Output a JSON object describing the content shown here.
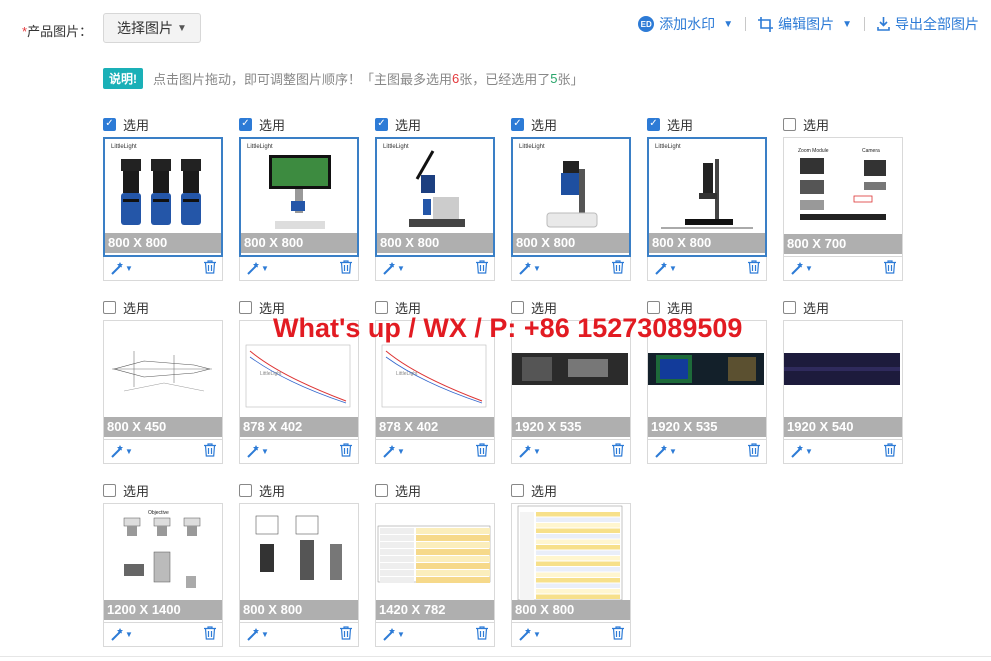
{
  "header": {
    "required_mark": "*",
    "label": "产品图片：",
    "select_button": "选择图片",
    "actions": [
      {
        "name": "add-watermark",
        "label": "添加水印",
        "icon": "watermark-icon"
      },
      {
        "name": "edit-image",
        "label": "编辑图片",
        "icon": "crop-icon"
      },
      {
        "name": "export-all",
        "label": "导出全部图片",
        "icon": "download-icon"
      }
    ]
  },
  "hint": {
    "badge": "说明!",
    "text": "点击图片拖动，即可调整图片顺序！「主图最多选用",
    "max_count": "6",
    "text_mid": "张，已经选用了",
    "selected_count": "5",
    "text_end": "张」"
  },
  "checkbox_label": "选用",
  "images": [
    {
      "selected": true,
      "size": "800 X 800",
      "kind": "cameras"
    },
    {
      "selected": true,
      "size": "800 X 800",
      "kind": "monitor-scope"
    },
    {
      "selected": true,
      "size": "800 X 800",
      "kind": "arm-scope"
    },
    {
      "selected": true,
      "size": "800 X 800",
      "kind": "stand-scope"
    },
    {
      "selected": true,
      "size": "800 X 800",
      "kind": "boom-scope"
    },
    {
      "selected": false,
      "size": "800 X 700",
      "kind": "module-diagram"
    },
    {
      "selected": false,
      "size": "800 X 450",
      "kind": "tech-drawing"
    },
    {
      "selected": false,
      "size": "878 X 402",
      "kind": "curve-chart"
    },
    {
      "selected": false,
      "size": "878 X 402",
      "kind": "curve-chart"
    },
    {
      "selected": false,
      "size": "1920 X 535",
      "kind": "dark-banner"
    },
    {
      "selected": false,
      "size": "1920 X 535",
      "kind": "green-banner"
    },
    {
      "selected": false,
      "size": "1920 X 540",
      "kind": "purple-banner"
    },
    {
      "selected": false,
      "size": "1200 X 1400",
      "kind": "lens-diagram"
    },
    {
      "selected": false,
      "size": "800 X 800",
      "kind": "lens-drawing"
    },
    {
      "selected": false,
      "size": "1420 X 782",
      "kind": "spec-table"
    },
    {
      "selected": false,
      "size": "800 X 800",
      "kind": "yellow-table"
    }
  ],
  "overlay_text": "What's up / WX / P: +86 15273089509",
  "colors": {
    "accent": "#2d7bd6",
    "badge": "#1ab0b7",
    "red": "#e4393c",
    "green": "#2aa56b"
  }
}
